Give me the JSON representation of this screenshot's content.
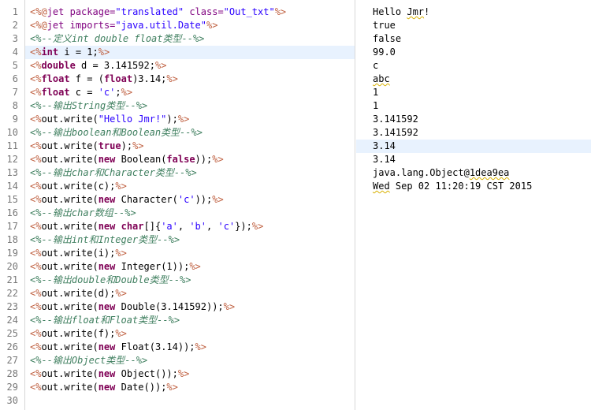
{
  "editor": {
    "lines": [
      {
        "n": "1",
        "parts": [
          [
            "d",
            "<%@"
          ],
          [
            "a",
            "jet "
          ],
          [
            "a",
            "package="
          ],
          [
            "s",
            "\"translated\""
          ],
          [
            "a",
            " class="
          ],
          [
            "s",
            "\"Out_txt\""
          ],
          [
            "d",
            "%>"
          ]
        ]
      },
      {
        "n": "2",
        "parts": [
          [
            "d",
            "<%@"
          ],
          [
            "a",
            "jet "
          ],
          [
            "a",
            "imports="
          ],
          [
            "s",
            "\"java.util.Date\""
          ],
          [
            "d",
            "%>"
          ]
        ]
      },
      {
        "n": "3",
        "parts": [
          [
            "c",
            "<%--定义int double float类型--%>"
          ]
        ]
      },
      {
        "n": "4",
        "hl": true,
        "parts": [
          [
            "d",
            "<%"
          ],
          [
            "k",
            "int"
          ],
          [
            "t",
            " i = 1;"
          ],
          [
            "d",
            "%>"
          ]
        ]
      },
      {
        "n": "5",
        "parts": [
          [
            "d",
            "<%"
          ],
          [
            "k",
            "double"
          ],
          [
            "t",
            " d = 3.141592;"
          ],
          [
            "d",
            "%>"
          ]
        ]
      },
      {
        "n": "6",
        "parts": [
          [
            "d",
            "<%"
          ],
          [
            "k",
            "float"
          ],
          [
            "t",
            " f = ("
          ],
          [
            "k",
            "float"
          ],
          [
            "t",
            ")3.14;"
          ],
          [
            "d",
            "%>"
          ]
        ]
      },
      {
        "n": "7",
        "parts": [
          [
            "d",
            "<%"
          ],
          [
            "k",
            "float"
          ],
          [
            "t",
            " c = "
          ],
          [
            "s",
            "'c'"
          ],
          [
            "t",
            ";"
          ],
          [
            "d",
            "%>"
          ]
        ]
      },
      {
        "n": "8",
        "parts": [
          [
            "c",
            "<%--输出String类型--%>"
          ]
        ]
      },
      {
        "n": "9",
        "parts": [
          [
            "d",
            "<%"
          ],
          [
            "t",
            "out.write("
          ],
          [
            "s",
            "\"Hello Jmr!\""
          ],
          [
            "t",
            ");"
          ],
          [
            "d",
            "%>"
          ]
        ]
      },
      {
        "n": "10",
        "parts": [
          [
            "c",
            "<%--输出boolean和Boolean类型--%>"
          ]
        ]
      },
      {
        "n": "11",
        "parts": [
          [
            "d",
            "<%"
          ],
          [
            "t",
            "out.write("
          ],
          [
            "k",
            "true"
          ],
          [
            "t",
            ");"
          ],
          [
            "d",
            "%>"
          ]
        ]
      },
      {
        "n": "12",
        "parts": [
          [
            "d",
            "<%"
          ],
          [
            "t",
            "out.write("
          ],
          [
            "k",
            "new"
          ],
          [
            "t",
            " Boolean("
          ],
          [
            "k",
            "false"
          ],
          [
            "t",
            "));"
          ],
          [
            "d",
            "%>"
          ]
        ]
      },
      {
        "n": "13",
        "parts": [
          [
            "c",
            "<%--输出char和Character类型--%>"
          ]
        ]
      },
      {
        "n": "14",
        "parts": [
          [
            "d",
            "<%"
          ],
          [
            "t",
            "out.write(c);"
          ],
          [
            "d",
            "%>"
          ]
        ]
      },
      {
        "n": "15",
        "parts": [
          [
            "d",
            "<%"
          ],
          [
            "t",
            "out.write("
          ],
          [
            "k",
            "new"
          ],
          [
            "t",
            " Character("
          ],
          [
            "s",
            "'c'"
          ],
          [
            "t",
            "));"
          ],
          [
            "d",
            "%>"
          ]
        ]
      },
      {
        "n": "16",
        "parts": [
          [
            "c",
            "<%--输出char数组--%>"
          ]
        ]
      },
      {
        "n": "17",
        "parts": [
          [
            "d",
            "<%"
          ],
          [
            "t",
            "out.write("
          ],
          [
            "k",
            "new char"
          ],
          [
            "t",
            "[]{"
          ],
          [
            "s",
            "'a'"
          ],
          [
            "t",
            ", "
          ],
          [
            "s",
            "'b'"
          ],
          [
            "t",
            ", "
          ],
          [
            "s",
            "'c'"
          ],
          [
            "t",
            "});"
          ],
          [
            "d",
            "%>"
          ]
        ]
      },
      {
        "n": "18",
        "parts": [
          [
            "c",
            "<%--输出int和Integer类型--%>"
          ]
        ]
      },
      {
        "n": "19",
        "parts": [
          [
            "d",
            "<%"
          ],
          [
            "t",
            "out.write(i);"
          ],
          [
            "d",
            "%>"
          ]
        ]
      },
      {
        "n": "20",
        "parts": [
          [
            "d",
            "<%"
          ],
          [
            "t",
            "out.write("
          ],
          [
            "k",
            "new"
          ],
          [
            "t",
            " Integer(1));"
          ],
          [
            "d",
            "%>"
          ]
        ]
      },
      {
        "n": "21",
        "parts": [
          [
            "c",
            "<%--输出double和Double类型--%>"
          ]
        ]
      },
      {
        "n": "22",
        "parts": [
          [
            "d",
            "<%"
          ],
          [
            "t",
            "out.write(d);"
          ],
          [
            "d",
            "%>"
          ]
        ]
      },
      {
        "n": "23",
        "parts": [
          [
            "d",
            "<%"
          ],
          [
            "t",
            "out.write("
          ],
          [
            "k",
            "new"
          ],
          [
            "t",
            " Double(3.141592));"
          ],
          [
            "d",
            "%>"
          ]
        ]
      },
      {
        "n": "24",
        "parts": [
          [
            "c",
            "<%--输出float和Float类型--%>"
          ]
        ]
      },
      {
        "n": "25",
        "parts": [
          [
            "d",
            "<%"
          ],
          [
            "t",
            "out.write(f);"
          ],
          [
            "d",
            "%>"
          ]
        ]
      },
      {
        "n": "26",
        "parts": [
          [
            "d",
            "<%"
          ],
          [
            "t",
            "out.write("
          ],
          [
            "k",
            "new"
          ],
          [
            "t",
            " Float(3.14));"
          ],
          [
            "d",
            "%>"
          ]
        ]
      },
      {
        "n": "27",
        "parts": [
          [
            "c",
            "<%--输出Object类型--%>"
          ]
        ]
      },
      {
        "n": "28",
        "parts": [
          [
            "d",
            "<%"
          ],
          [
            "t",
            "out.write("
          ],
          [
            "k",
            "new"
          ],
          [
            "t",
            " Object());"
          ],
          [
            "d",
            "%>"
          ]
        ]
      },
      {
        "n": "29",
        "parts": [
          [
            "d",
            "<%"
          ],
          [
            "t",
            "out.write("
          ],
          [
            "k",
            "new"
          ],
          [
            "t",
            " Date());"
          ],
          [
            "d",
            "%>"
          ]
        ]
      },
      {
        "n": "30",
        "parts": []
      }
    ]
  },
  "output": {
    "lines": [
      {
        "text": "Hello Jmr!",
        "squiggle": "Jmr"
      },
      {
        "text": "true"
      },
      {
        "text": "false"
      },
      {
        "text": "99.0"
      },
      {
        "text": "c"
      },
      {
        "text": "abc",
        "squiggle": "abc"
      },
      {
        "text": "1"
      },
      {
        "text": "1"
      },
      {
        "text": "3.141592"
      },
      {
        "text": "3.141592"
      },
      {
        "text": "3.14",
        "hl": true
      },
      {
        "text": "3.14"
      },
      {
        "text": "java.lang.Object@1dea9ea",
        "squiggle": "1dea9ea"
      },
      {
        "text": "Wed Sep 02 11:20:19 CST 2015",
        "squiggle": "Wed"
      }
    ]
  },
  "colors": {
    "delimiter": "#bf5f3f",
    "keyword": "#7f0055",
    "string": "#2a00ff",
    "comment": "#3f7f5f",
    "attribute": "#7f007f",
    "current_line": "#e8f2fe"
  }
}
